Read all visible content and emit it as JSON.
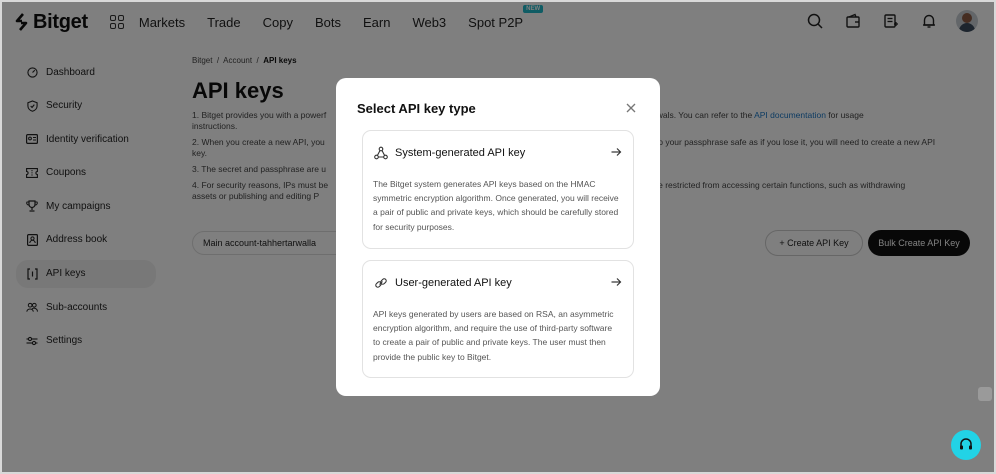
{
  "header": {
    "brand": "Bitget",
    "nav": [
      "Markets",
      "Trade",
      "Copy",
      "Bots",
      "Earn",
      "Web3",
      "Spot P2P"
    ],
    "nav_badge": "NEW",
    "icons": [
      "search-icon",
      "wallet-icon",
      "orders-icon",
      "bell-icon",
      "avatar"
    ]
  },
  "sidebar": {
    "items": [
      {
        "label": "Dashboard",
        "icon": "dashboard-icon"
      },
      {
        "label": "Security",
        "icon": "shield-icon"
      },
      {
        "label": "Identity verification",
        "icon": "id-card-icon"
      },
      {
        "label": "Coupons",
        "icon": "coupon-icon"
      },
      {
        "label": "My campaigns",
        "icon": "trophy-icon"
      },
      {
        "label": "Address book",
        "icon": "address-book-icon"
      },
      {
        "label": "API keys",
        "icon": "api-icon"
      },
      {
        "label": "Sub-accounts",
        "icon": "users-icon"
      },
      {
        "label": "Settings",
        "icon": "sliders-icon"
      }
    ],
    "active": "API keys"
  },
  "main": {
    "breadcrumb": {
      "a": "Bitget",
      "sep": "/",
      "b": "Account",
      "c": "API keys"
    },
    "title": "API keys",
    "note1a": "1. Bitget provides you with a powerf",
    "note1b": "make withdrawals. You can refer to the ",
    "note1_link": "API documentation",
    "note1c": " for usage",
    "note1d": "instructions.",
    "note2a": "2. When you create a new API, you",
    "note2b": "eep your passphrase safe as if you lose it, you will need to create a new API",
    "note2c": "key.",
    "note3": "3. The secret and passphrase are u",
    "note4a": "4. For security reasons, IPs must be",
    "note4b": "ay be restricted from accessing certain functions, such as withdrawing",
    "note4c": "assets or publishing and editing P",
    "account_select": "Main account-tahhertarwalla",
    "create_btn": "+  Create API Key",
    "bulk_btn": "Bulk Create API Key"
  },
  "modal": {
    "title": "Select API key type",
    "options": [
      {
        "title": "System-generated API key",
        "desc": "The Bitget system generates API keys based on the HMAC symmetric encryption algorithm. Once generated, you will receive a pair of public and private keys, which should be carefully stored for security purposes."
      },
      {
        "title": "User-generated API key",
        "desc": "API keys generated by users are based on RSA, an asymmetric encryption algorithm, and require the use of third-party software to create a pair of public and private keys. The user must then provide the public key to Bitget."
      }
    ]
  },
  "colors": {
    "accent": "#1fb8c9",
    "support": "#22d3e6",
    "link": "#1a76c4",
    "bulk_btn": "#111111"
  }
}
